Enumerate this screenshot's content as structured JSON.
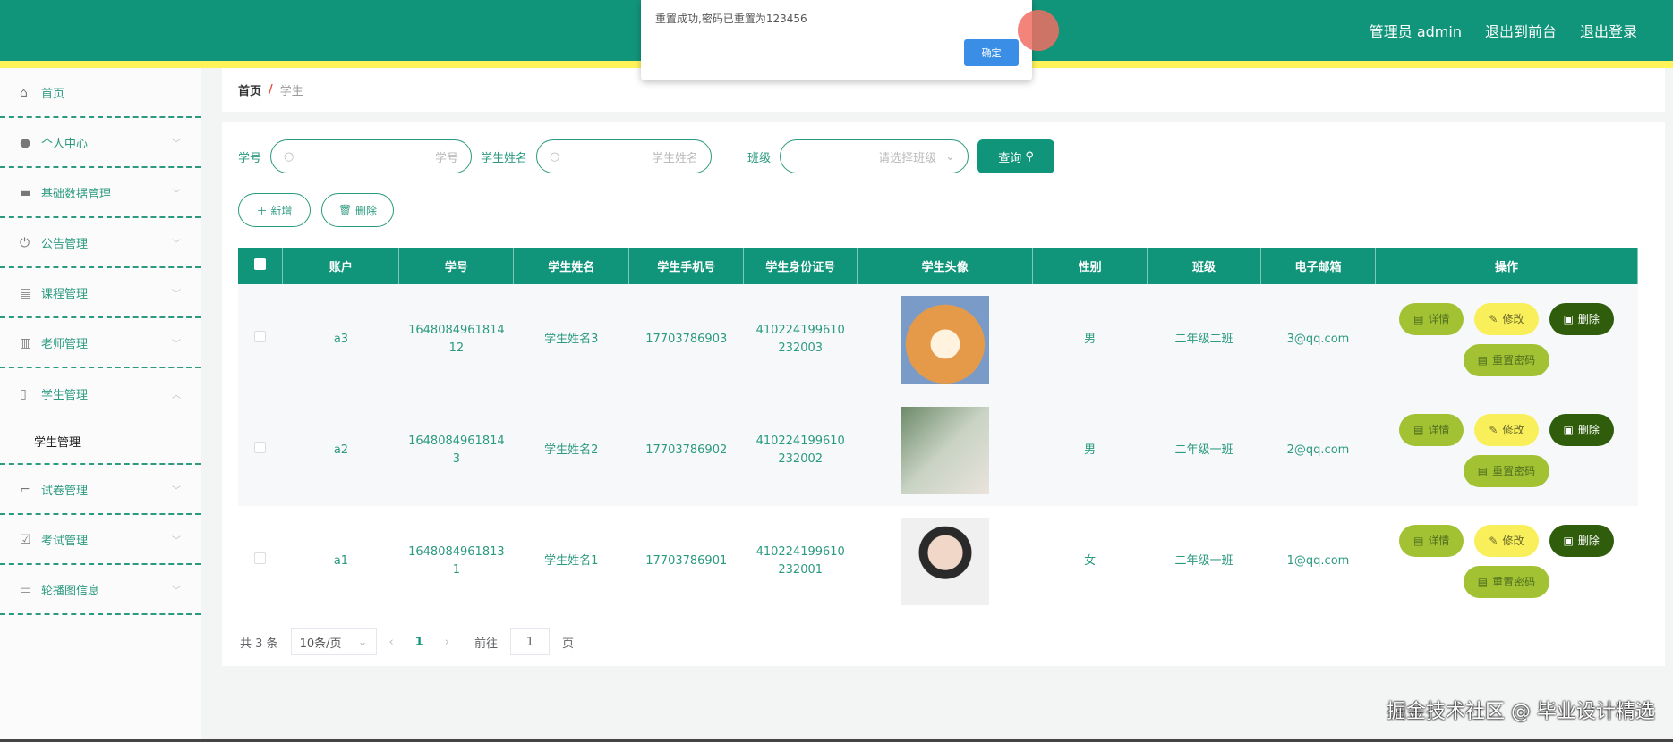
{
  "header": {
    "user": "管理员 admin",
    "front": "退出到前台",
    "logout": "退出登录"
  },
  "dialog": {
    "message": "重置成功,密码已重置为123456",
    "ok": "确定"
  },
  "sidebar": {
    "items": [
      {
        "label": "首页",
        "icon": "home-icon"
      },
      {
        "label": "个人中心",
        "icon": "user-icon"
      },
      {
        "label": "基础数据管理",
        "icon": "briefcase-icon"
      },
      {
        "label": "公告管理",
        "icon": "power-icon"
      },
      {
        "label": "课程管理",
        "icon": "clipboard-icon"
      },
      {
        "label": "老师管理",
        "icon": "books-icon"
      },
      {
        "label": "学生管理",
        "icon": "microphone-icon"
      },
      {
        "label": "试卷管理",
        "icon": "crop-icon"
      },
      {
        "label": "考试管理",
        "icon": "checklist-icon"
      },
      {
        "label": "轮播图信息",
        "icon": "monitor-icon"
      }
    ],
    "sub": "学生管理"
  },
  "breadcrumb": {
    "home": "首页",
    "sep": "/",
    "current": "学生"
  },
  "search": {
    "no_label": "学号",
    "no_ph": "学号",
    "name_label": "学生姓名",
    "name_ph": "学生姓名",
    "class_label": "班级",
    "class_ph": "请选择班级",
    "query": "查询"
  },
  "actions": {
    "add": "新增",
    "delete": "删除"
  },
  "table": {
    "headers": [
      "账户",
      "学号",
      "学生姓名",
      "学生手机号",
      "学生身份证号",
      "学生头像",
      "性别",
      "班级",
      "电子邮箱",
      "操作"
    ],
    "rows": [
      {
        "account": "a3",
        "no": "164808496181412",
        "name": "学生姓名3",
        "phone": "17703786903",
        "id": "410224199610232003",
        "gender": "男",
        "class": "二年级二班",
        "email": "3@qq.com"
      },
      {
        "account": "a2",
        "no": "16480849618143",
        "name": "学生姓名2",
        "phone": "17703786902",
        "id": "410224199610232002",
        "gender": "男",
        "class": "二年级一班",
        "email": "2@qq.com"
      },
      {
        "account": "a1",
        "no": "16480849618131",
        "name": "学生姓名1",
        "phone": "17703786901",
        "id": "410224199610232001",
        "gender": "女",
        "class": "二年级一班",
        "email": "1@qq.com"
      }
    ],
    "ops": {
      "detail": "详情",
      "edit": "修改",
      "delete": "删除",
      "reset": "重置密码"
    }
  },
  "pager": {
    "total": "共 3 条",
    "size": "10条/页",
    "page": "1",
    "goto": "前往",
    "goto_val": "1",
    "page_unit": "页"
  },
  "watermark": "掘金技术社区 @ 毕业设计精选",
  "colors": {
    "primary": "#11957a",
    "strip": "#fff35a",
    "detail": "#a2c234",
    "edit": "#f8ef5a",
    "delete": "#2f5d0c"
  }
}
